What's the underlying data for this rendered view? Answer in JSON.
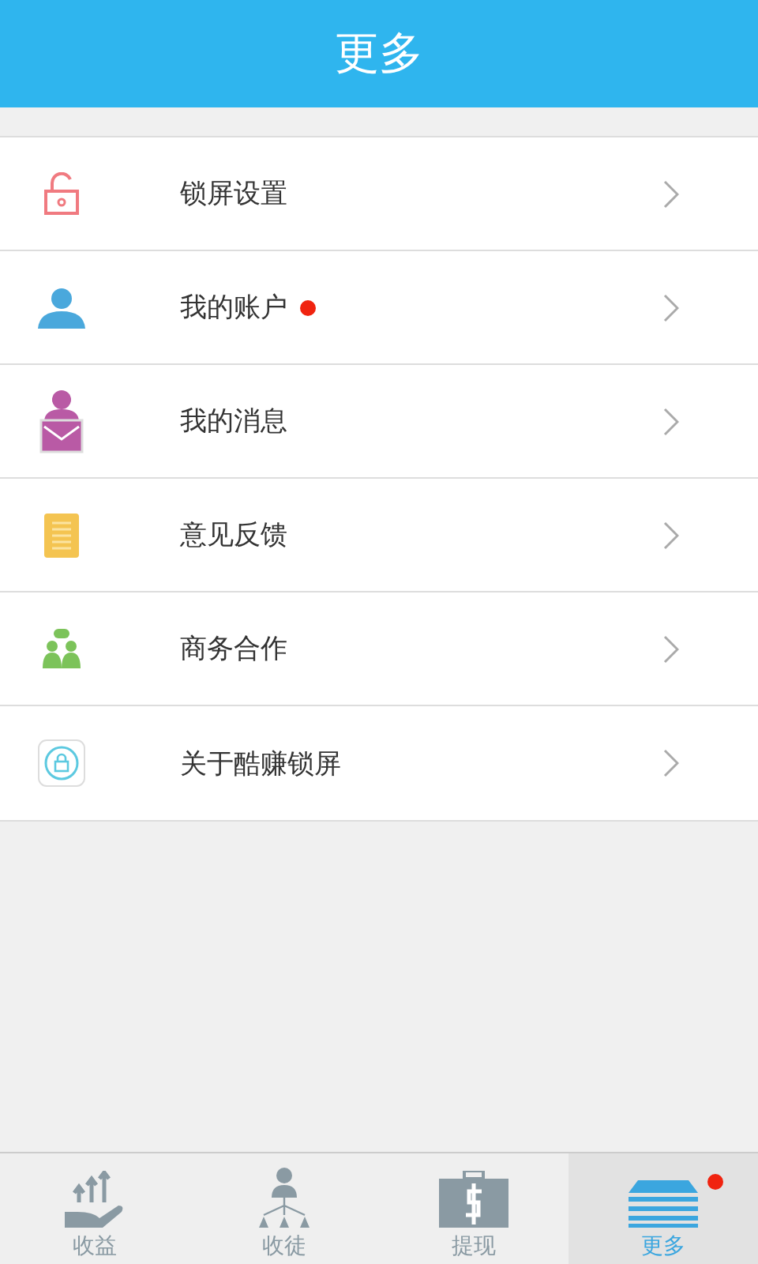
{
  "header": {
    "title": "更多"
  },
  "menu": [
    {
      "kind": "lock",
      "label": "锁屏设置",
      "badge": false
    },
    {
      "kind": "user",
      "label": "我的账户",
      "badge": true
    },
    {
      "kind": "message",
      "label": "我的消息",
      "badge": false
    },
    {
      "kind": "feedback",
      "label": "意见反馈",
      "badge": false
    },
    {
      "kind": "business",
      "label": "商务合作",
      "badge": false
    },
    {
      "kind": "about",
      "label": "关于酷赚锁屏",
      "badge": false
    }
  ],
  "tabs": [
    {
      "kind": "income",
      "label": "收益",
      "selected": false,
      "badge": false
    },
    {
      "kind": "apprentice",
      "label": "收徒",
      "selected": false,
      "badge": false
    },
    {
      "kind": "withdraw",
      "label": "提现",
      "selected": false,
      "badge": false
    },
    {
      "kind": "more",
      "label": "更多",
      "selected": true,
      "badge": true
    }
  ]
}
